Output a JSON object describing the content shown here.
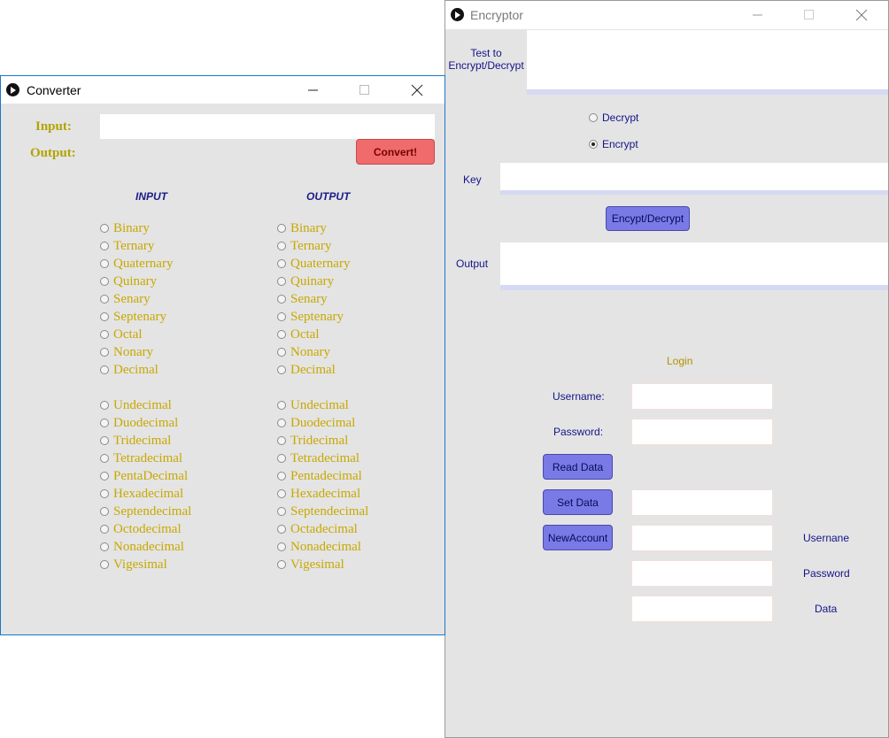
{
  "converter": {
    "title": "Converter",
    "input_label": "Input:",
    "output_label": "Output:",
    "input_value": "",
    "convert_label": "Convert!",
    "input_column_header": "INPUT",
    "output_column_header": "OUTPUT",
    "bases_group1": [
      "Binary",
      "Ternary",
      "Quaternary",
      "Quinary",
      "Senary",
      "Septenary",
      "Octal",
      "Nonary",
      "Decimal"
    ],
    "bases_group2": [
      "Undecimal",
      "Duodecimal",
      "Tridecimal",
      "Tetradecimal",
      "PentaDecimal",
      "Hexadecimal",
      "Septendecimal",
      "Octodecimal",
      "Nonadecimal",
      "Vigesimal"
    ],
    "output_bases_group2": [
      "Undecimal",
      "Duodecimal",
      "Tridecimal",
      "Tetradecimal",
      "Pentadecimal",
      "Hexadecimal",
      "Septendecimal",
      "Octadecimal",
      "Nonadecimal",
      "Vigesimal"
    ]
  },
  "encryptor": {
    "title": "Encryptor",
    "text_label": "Test to Encrypt/Decrypt",
    "text_value": "",
    "decrypt_label": "Decrypt",
    "encrypt_label": "Encrypt",
    "selected_mode": "Encrypt",
    "key_label": "Key",
    "key_value": "",
    "run_button": "Encypt/Decrypt",
    "output_label": "Output",
    "output_value": "",
    "login": {
      "heading": "Login",
      "username_label": "Username:",
      "password_label": "Password:",
      "read_button": "Read Data",
      "set_button": "Set Data",
      "new_account_button": "NewAccount",
      "new_username_label": "Usernane",
      "new_password_label": "Password",
      "data_label": "Data"
    }
  },
  "colors": {
    "convert_button": "#f06b6b",
    "purple_button": "#7a7ae6",
    "gold_text": "#c8a800",
    "navy_text": "#14148a"
  }
}
